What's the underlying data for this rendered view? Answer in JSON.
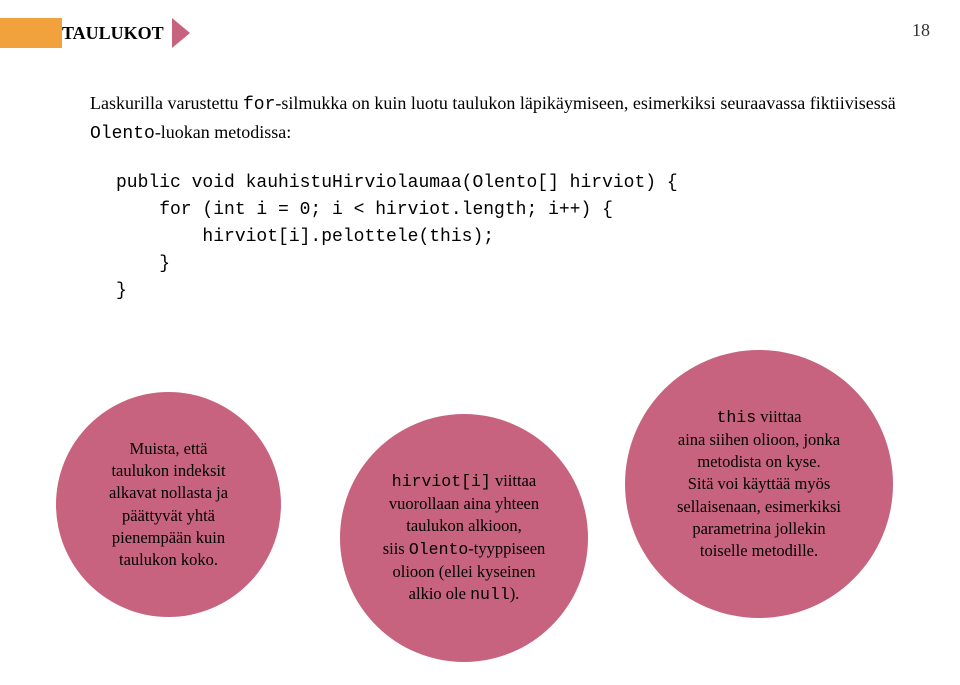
{
  "header": {
    "title": "TAULUKOT",
    "page_number": "18"
  },
  "intro": {
    "part1": "Laskurilla varustettu ",
    "mono1": "for",
    "part2": "-silmukka on kuin luotu taulukon läpikäymiseen, esimerkiksi seuraavassa fiktiivisessä ",
    "mono2": "Olento",
    "part3": "-luokan metodissa:"
  },
  "code": "public void kauhistuHirviolaumaa(Olento[] hirviot) {\n    for (int i = 0; i < hirviot.length; i++) {\n        hirviot[i].pelottele(this);\n    }\n}",
  "bubble1": {
    "l1": "Muista, että",
    "l2": "taulukon indeksit",
    "l3": "alkavat nollasta ja",
    "l4": "päättyvät yhtä",
    "l5": "pienempään kuin",
    "l6": "taulukon koko."
  },
  "bubble2": {
    "mono1": "hirviot[i]",
    "t1": " viittaa",
    "l2": "vuorollaan aina yhteen",
    "l3": "taulukon alkioon,",
    "t4a": "siis ",
    "mono2": "Olento",
    "t4b": "-tyyppiseen",
    "l5": "olioon (ellei kyseinen",
    "t6a": "alkio ole ",
    "mono3": "null",
    "t6b": ")."
  },
  "bubble3": {
    "mono1": "this",
    "t1": " viittaa",
    "l2": "aina siihen olioon, jonka",
    "l3": "metodista on kyse.",
    "l4": "Sitä voi käyttää myös",
    "l5": "sellaisenaan, esimerkiksi",
    "l6": "parametrina jollekin",
    "l7": "toiselle metodille."
  }
}
